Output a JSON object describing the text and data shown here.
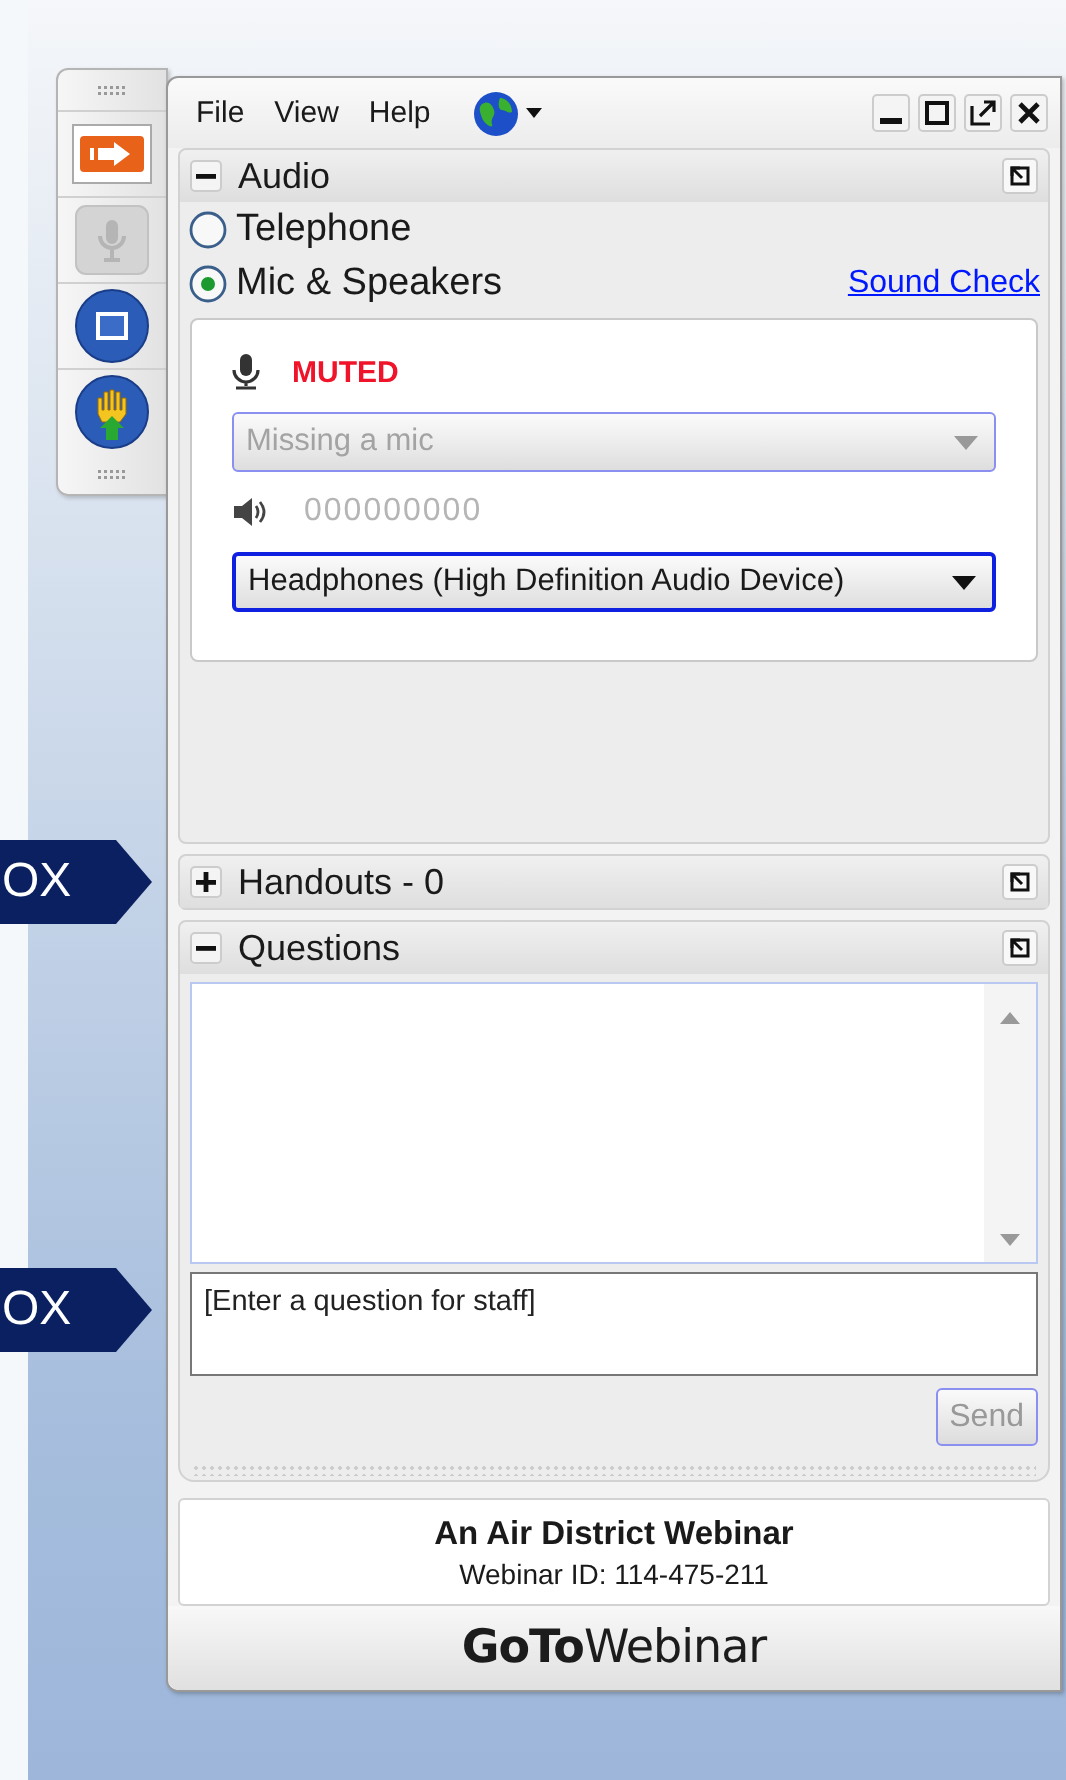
{
  "menu": [
    {
      "label": "File"
    },
    {
      "label": "View"
    },
    {
      "label": "Help"
    }
  ],
  "audio": {
    "title": "Audio",
    "expanded": true,
    "options": [
      {
        "label": "Telephone",
        "selected": false
      },
      {
        "label": "Mic & Speakers",
        "selected": true
      }
    ],
    "sound_check": "Sound Check",
    "mic_status": "MUTED",
    "mic_select": {
      "value": "Missing a mic",
      "disabled": true
    },
    "speaker_meter": "000000000",
    "speaker_select": {
      "value": "Headphones (High Definition Audio Device)",
      "disabled": false
    }
  },
  "handouts": {
    "title": "Handouts - 0",
    "expanded": false
  },
  "questions": {
    "title": "Questions",
    "expanded": true,
    "placeholder": "[Enter a question for staff]",
    "send": {
      "label": "Send",
      "disabled": true
    }
  },
  "webinar": {
    "title": "An Air District Webinar",
    "id": "Webinar ID: 114-475-211"
  },
  "logo": {
    "bold": "GoTo",
    "light": "Webinar"
  },
  "callouts": [
    {
      "label": "OX"
    },
    {
      "label": "OX"
    }
  ]
}
